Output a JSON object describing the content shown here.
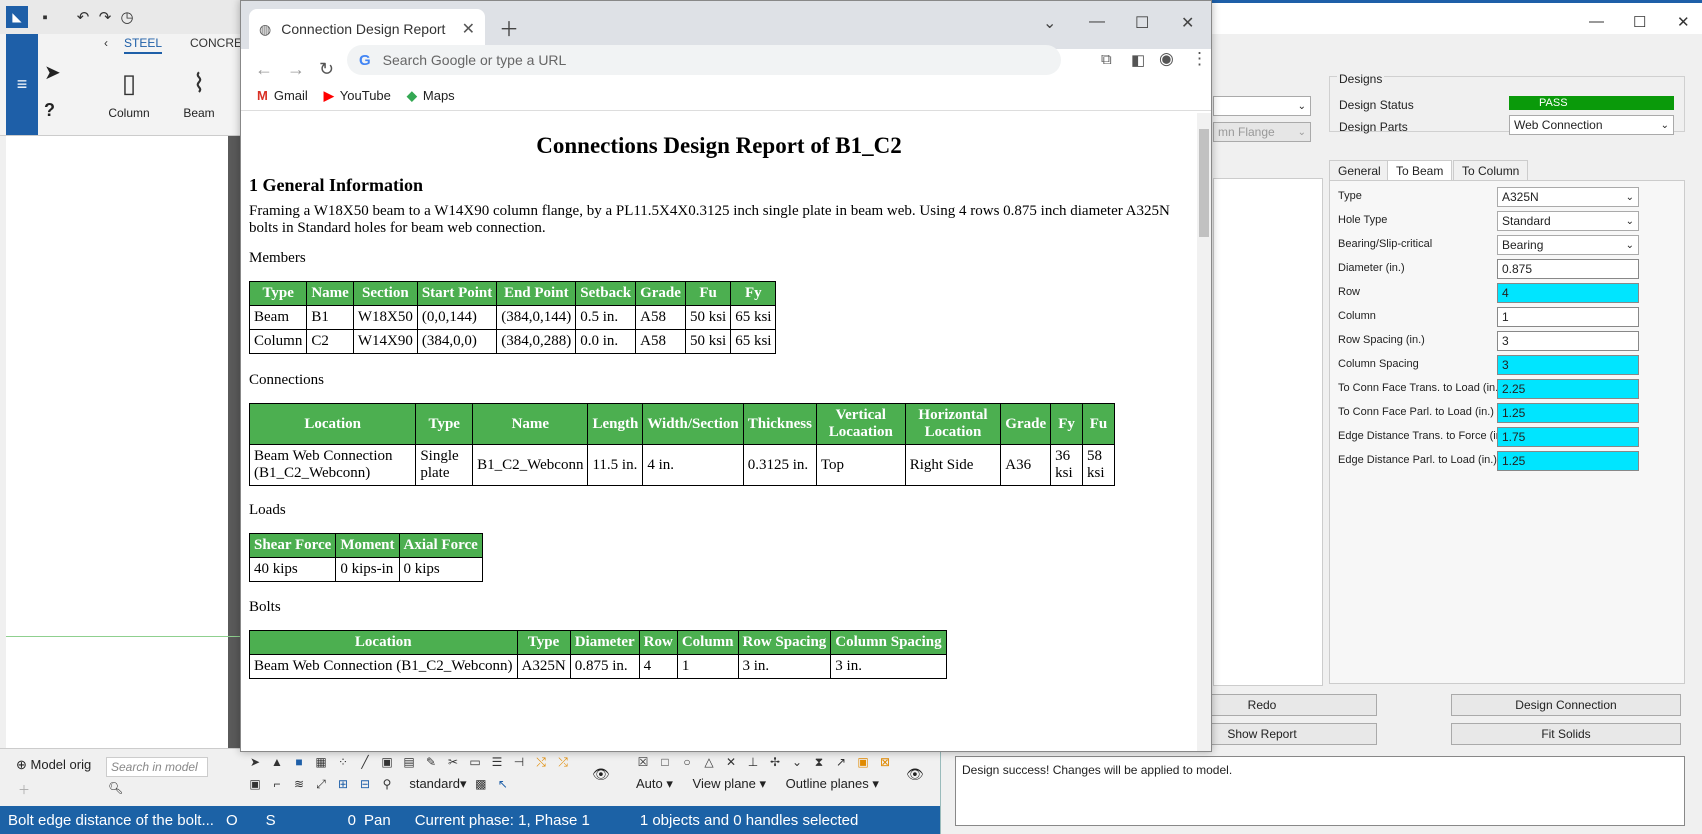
{
  "cad": {
    "tab_steel": "STEEL",
    "tab_concrete": "CONCRET",
    "tool_column": "Column",
    "tool_beam": "Beam",
    "model_orig": "Model orig",
    "search_placeholder": "Search in model",
    "standard_dd": "standard",
    "auto_dd": "Auto",
    "view_plane_dd": "View plane",
    "outline_planes_dd": "Outline planes"
  },
  "status": {
    "message": "Bolt edge distance of the bolt...",
    "o": "O",
    "s": "S",
    "zero": "0",
    "pan": "Pan",
    "phase": "Current phase: 1, Phase 1",
    "selection": "1 objects and 0 handles selected"
  },
  "browser": {
    "tab_title": "Connection Design Report",
    "url_placeholder": "Search Google or type a URL",
    "bookmarks": [
      "Gmail",
      "YouTube",
      "Maps"
    ]
  },
  "report": {
    "title": "Connections Design Report of B1_C2",
    "section1": "1 General Information",
    "intro": "Framing a W18X50 beam to a W14X90 column flange, by a PL11.5X4X0.3125 inch single plate in beam web. Using 4 rows 0.875 inch diameter A325N bolts in Standard holes for beam web connection.",
    "members_label": "Members",
    "members_headers": [
      "Type",
      "Name",
      "Section",
      "Start Point",
      "End Point",
      "Setback",
      "Grade",
      "Fu",
      "Fy"
    ],
    "members_rows": [
      [
        "Beam",
        "B1",
        "W18X50",
        "(0,0,144)",
        "(384,0,144)",
        "0.5 in.",
        "A58",
        "50 ksi",
        "65 ksi"
      ],
      [
        "Column",
        "C2",
        "W14X90",
        "(384,0,0)",
        "(384,0,288)",
        "0.0 in.",
        "A58",
        "50 ksi",
        "65 ksi"
      ]
    ],
    "connections_label": "Connections",
    "connections_headers": [
      "Location",
      "Type",
      "Name",
      "Length",
      "Width/Section",
      "Thickness",
      "Vertical Locaation",
      "Horizontal Location",
      "Grade",
      "Fy",
      "Fu"
    ],
    "connections_rows": [
      [
        "Beam Web Connection (B1_C2_Webconn)",
        "Single plate",
        "B1_C2_Webconn",
        "11.5 in.",
        "4 in.",
        "0.3125 in.",
        "Top",
        "Right Side",
        "A36",
        "36 ksi",
        "58 ksi"
      ]
    ],
    "loads_label": "Loads",
    "loads_headers": [
      "Shear Force",
      "Moment",
      "Axial Force"
    ],
    "loads_rows": [
      [
        "40 kips",
        "0 kips-in",
        "0 kips"
      ]
    ],
    "bolts_label": "Bolts",
    "bolts_headers": [
      "Location",
      "Type",
      "Diameter",
      "Row",
      "Column",
      "Row Spacing",
      "Column Spacing"
    ],
    "bolts_rows": [
      [
        "Beam Web Connection (B1_C2_Webconn)",
        "A325N",
        "0.875 in.",
        "4",
        "1",
        "3 in.",
        "3 in."
      ]
    ]
  },
  "dialog": {
    "partial_select2": "mn Flange",
    "designs_label": "Designs",
    "design_status_label": "Design Status",
    "design_status_value": "PASS",
    "design_parts_label": "Design Parts",
    "design_parts_value": "Web Connection",
    "tabs": [
      "General",
      "To Beam",
      "To Column"
    ],
    "fields": [
      {
        "label": "Type",
        "value": "A325N",
        "kind": "select",
        "highlight": false
      },
      {
        "label": "Hole Type",
        "value": "Standard",
        "kind": "select",
        "highlight": false
      },
      {
        "label": "Bearing/Slip-critical",
        "value": "Bearing",
        "kind": "select",
        "highlight": false
      },
      {
        "label": "Diameter (in.)",
        "value": "0.875",
        "kind": "input",
        "highlight": false
      },
      {
        "label": "Row",
        "value": "4",
        "kind": "input",
        "highlight": true
      },
      {
        "label": "Column",
        "value": "1",
        "kind": "input",
        "highlight": false
      },
      {
        "label": "Row Spacing (in.)",
        "value": "3",
        "kind": "input",
        "highlight": false
      },
      {
        "label": "Column Spacing",
        "value": "3",
        "kind": "input",
        "highlight": true
      },
      {
        "label": "To Conn Face Trans. to Load (in.)",
        "value": "2.25",
        "kind": "input",
        "highlight": true
      },
      {
        "label": "To Conn Face Parl. to Load (in.)",
        "value": "1.25",
        "kind": "input",
        "highlight": true
      },
      {
        "label": "Edge Distance Trans. to Force (in.)",
        "value": "1.75",
        "kind": "input",
        "highlight": true
      },
      {
        "label": "Edge Distance Parl. to Load (in.)",
        "value": "1.25",
        "kind": "input",
        "highlight": true
      }
    ],
    "redo": "Redo",
    "design_connection": "Design Connection",
    "show_report": "Show Report",
    "fit_solids": "Fit Solids",
    "message": "Design success! Changes will be applied to model."
  }
}
